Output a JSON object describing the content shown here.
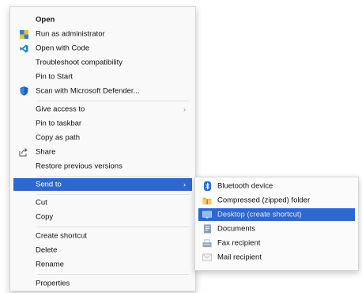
{
  "context_menu": {
    "items": [
      {
        "label": "Open"
      },
      {
        "label": "Run as administrator",
        "icon": "shield-icon"
      },
      {
        "label": "Open with Code",
        "icon": "vscode-icon"
      },
      {
        "label": "Troubleshoot compatibility"
      },
      {
        "label": "Pin to Start"
      },
      {
        "label": "Scan with Microsoft Defender...",
        "icon": "defender-shield-icon"
      },
      {
        "label": "Give access to"
      },
      {
        "label": "Pin to taskbar"
      },
      {
        "label": "Copy as path"
      },
      {
        "label": "Share",
        "icon": "share-icon"
      },
      {
        "label": "Restore previous versions"
      },
      {
        "label": "Send to"
      },
      {
        "label": "Cut"
      },
      {
        "label": "Copy"
      },
      {
        "label": "Create shortcut"
      },
      {
        "label": "Delete"
      },
      {
        "label": "Rename"
      },
      {
        "label": "Properties"
      }
    ],
    "chevron": "›"
  },
  "send_to_menu": {
    "items": [
      {
        "label": "Bluetooth device",
        "icon": "bluetooth-icon"
      },
      {
        "label": "Compressed (zipped) folder",
        "icon": "zip-folder-icon"
      },
      {
        "label": "Desktop (create shortcut)",
        "icon": "desktop-icon"
      },
      {
        "label": "Documents",
        "icon": "documents-icon"
      },
      {
        "label": "Fax recipient",
        "icon": "fax-icon"
      },
      {
        "label": "Mail recipient",
        "icon": "mail-icon"
      }
    ]
  },
  "colors": {
    "highlight": "#2f67d0",
    "menu_background": "#f9f9f9",
    "separator": "#e1e1e1"
  }
}
